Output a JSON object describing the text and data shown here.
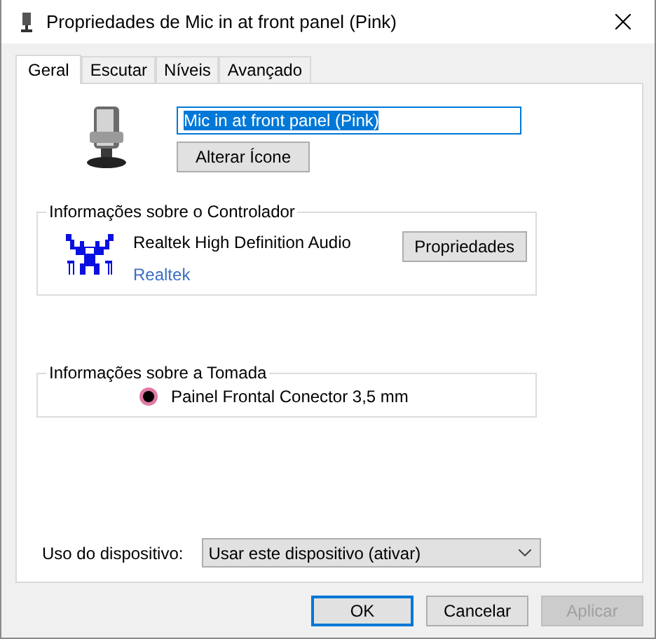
{
  "window": {
    "title": "Propriedades de Mic in at front panel (Pink)"
  },
  "tabs": [
    {
      "label": "Geral",
      "selected": true
    },
    {
      "label": "Escutar",
      "selected": false
    },
    {
      "label": "Níveis",
      "selected": false
    },
    {
      "label": "Avançado",
      "selected": false
    }
  ],
  "device": {
    "name": "Mic in at front panel (Pink)",
    "name_highlighted": true,
    "change_icon_button": "Alterar Ícone"
  },
  "controller": {
    "title": "Informações sobre o Controlador",
    "name": "Realtek High Definition Audio",
    "vendor": "Realtek",
    "properties_button": "Propriedades"
  },
  "jack": {
    "title": "Informações sobre a Tomada",
    "description": "Painel Frontal Conector 3,5 mm"
  },
  "usage": {
    "label": "Uso do dispositivo:",
    "value": "Usar este dispositivo (ativar)"
  },
  "buttons": [
    {
      "label": "OK",
      "default": true,
      "disabled": false
    },
    {
      "label": "Cancelar",
      "default": false,
      "disabled": false
    },
    {
      "label": "Aplicar",
      "default": false,
      "disabled": true
    }
  ]
}
